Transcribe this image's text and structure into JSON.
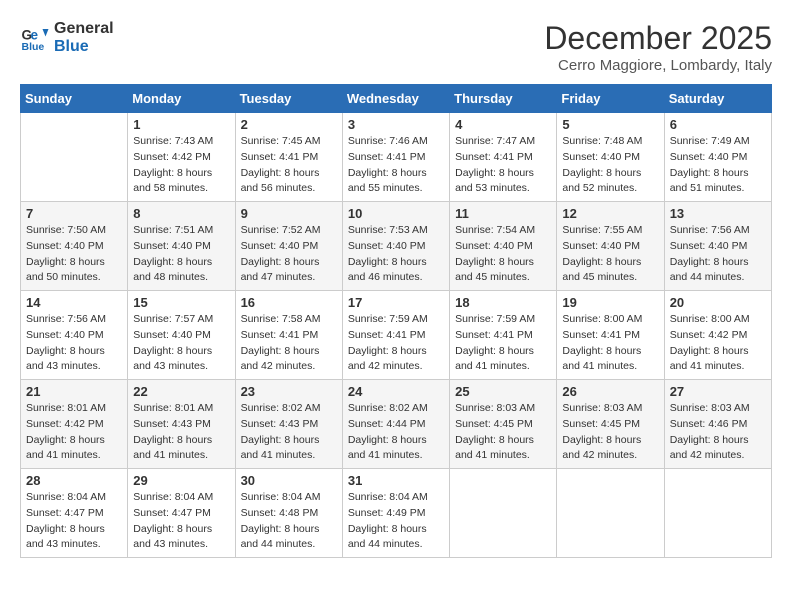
{
  "logo": {
    "line1": "General",
    "line2": "Blue"
  },
  "title": "December 2025",
  "subtitle": "Cerro Maggiore, Lombardy, Italy",
  "weekdays": [
    "Sunday",
    "Monday",
    "Tuesday",
    "Wednesday",
    "Thursday",
    "Friday",
    "Saturday"
  ],
  "weeks": [
    [
      null,
      {
        "day": 1,
        "sunrise": "7:43 AM",
        "sunset": "4:42 PM",
        "daylight": "8 hours and 58 minutes."
      },
      {
        "day": 2,
        "sunrise": "7:45 AM",
        "sunset": "4:41 PM",
        "daylight": "8 hours and 56 minutes."
      },
      {
        "day": 3,
        "sunrise": "7:46 AM",
        "sunset": "4:41 PM",
        "daylight": "8 hours and 55 minutes."
      },
      {
        "day": 4,
        "sunrise": "7:47 AM",
        "sunset": "4:41 PM",
        "daylight": "8 hours and 53 minutes."
      },
      {
        "day": 5,
        "sunrise": "7:48 AM",
        "sunset": "4:40 PM",
        "daylight": "8 hours and 52 minutes."
      },
      {
        "day": 6,
        "sunrise": "7:49 AM",
        "sunset": "4:40 PM",
        "daylight": "8 hours and 51 minutes."
      }
    ],
    [
      {
        "day": 7,
        "sunrise": "7:50 AM",
        "sunset": "4:40 PM",
        "daylight": "8 hours and 50 minutes."
      },
      {
        "day": 8,
        "sunrise": "7:51 AM",
        "sunset": "4:40 PM",
        "daylight": "8 hours and 48 minutes."
      },
      {
        "day": 9,
        "sunrise": "7:52 AM",
        "sunset": "4:40 PM",
        "daylight": "8 hours and 47 minutes."
      },
      {
        "day": 10,
        "sunrise": "7:53 AM",
        "sunset": "4:40 PM",
        "daylight": "8 hours and 46 minutes."
      },
      {
        "day": 11,
        "sunrise": "7:54 AM",
        "sunset": "4:40 PM",
        "daylight": "8 hours and 45 minutes."
      },
      {
        "day": 12,
        "sunrise": "7:55 AM",
        "sunset": "4:40 PM",
        "daylight": "8 hours and 45 minutes."
      },
      {
        "day": 13,
        "sunrise": "7:56 AM",
        "sunset": "4:40 PM",
        "daylight": "8 hours and 44 minutes."
      }
    ],
    [
      {
        "day": 14,
        "sunrise": "7:56 AM",
        "sunset": "4:40 PM",
        "daylight": "8 hours and 43 minutes."
      },
      {
        "day": 15,
        "sunrise": "7:57 AM",
        "sunset": "4:40 PM",
        "daylight": "8 hours and 43 minutes."
      },
      {
        "day": 16,
        "sunrise": "7:58 AM",
        "sunset": "4:41 PM",
        "daylight": "8 hours and 42 minutes."
      },
      {
        "day": 17,
        "sunrise": "7:59 AM",
        "sunset": "4:41 PM",
        "daylight": "8 hours and 42 minutes."
      },
      {
        "day": 18,
        "sunrise": "7:59 AM",
        "sunset": "4:41 PM",
        "daylight": "8 hours and 41 minutes."
      },
      {
        "day": 19,
        "sunrise": "8:00 AM",
        "sunset": "4:41 PM",
        "daylight": "8 hours and 41 minutes."
      },
      {
        "day": 20,
        "sunrise": "8:00 AM",
        "sunset": "4:42 PM",
        "daylight": "8 hours and 41 minutes."
      }
    ],
    [
      {
        "day": 21,
        "sunrise": "8:01 AM",
        "sunset": "4:42 PM",
        "daylight": "8 hours and 41 minutes."
      },
      {
        "day": 22,
        "sunrise": "8:01 AM",
        "sunset": "4:43 PM",
        "daylight": "8 hours and 41 minutes."
      },
      {
        "day": 23,
        "sunrise": "8:02 AM",
        "sunset": "4:43 PM",
        "daylight": "8 hours and 41 minutes."
      },
      {
        "day": 24,
        "sunrise": "8:02 AM",
        "sunset": "4:44 PM",
        "daylight": "8 hours and 41 minutes."
      },
      {
        "day": 25,
        "sunrise": "8:03 AM",
        "sunset": "4:45 PM",
        "daylight": "8 hours and 41 minutes."
      },
      {
        "day": 26,
        "sunrise": "8:03 AM",
        "sunset": "4:45 PM",
        "daylight": "8 hours and 42 minutes."
      },
      {
        "day": 27,
        "sunrise": "8:03 AM",
        "sunset": "4:46 PM",
        "daylight": "8 hours and 42 minutes."
      }
    ],
    [
      {
        "day": 28,
        "sunrise": "8:04 AM",
        "sunset": "4:47 PM",
        "daylight": "8 hours and 43 minutes."
      },
      {
        "day": 29,
        "sunrise": "8:04 AM",
        "sunset": "4:47 PM",
        "daylight": "8 hours and 43 minutes."
      },
      {
        "day": 30,
        "sunrise": "8:04 AM",
        "sunset": "4:48 PM",
        "daylight": "8 hours and 44 minutes."
      },
      {
        "day": 31,
        "sunrise": "8:04 AM",
        "sunset": "4:49 PM",
        "daylight": "8 hours and 44 minutes."
      },
      null,
      null,
      null
    ]
  ]
}
